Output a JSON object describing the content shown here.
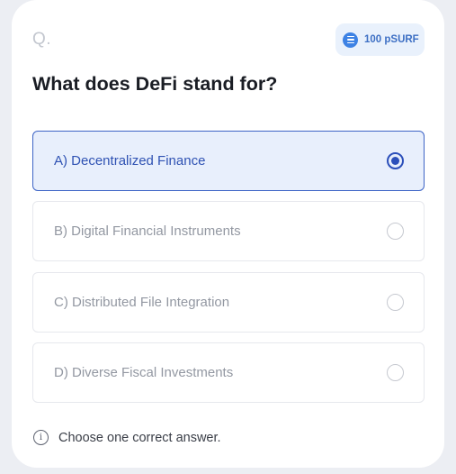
{
  "question": {
    "label": "Q.",
    "text": "What does DeFi stand for?"
  },
  "reward": {
    "amount": "100 pSURF",
    "icon": "coin-icon"
  },
  "options": [
    {
      "label": "A) Decentralized Finance",
      "selected": true
    },
    {
      "label": "B) Digital Financial Instruments",
      "selected": false
    },
    {
      "label": "C) Distributed File Integration",
      "selected": false
    },
    {
      "label": "D) Diverse Fiscal Investments",
      "selected": false
    }
  ],
  "hint": {
    "icon": "info-icon",
    "text": "Choose one correct answer."
  },
  "colors": {
    "accent": "#2b4fba",
    "selected_bg": "#e8effc",
    "reward_bg": "#e9f1fc"
  }
}
